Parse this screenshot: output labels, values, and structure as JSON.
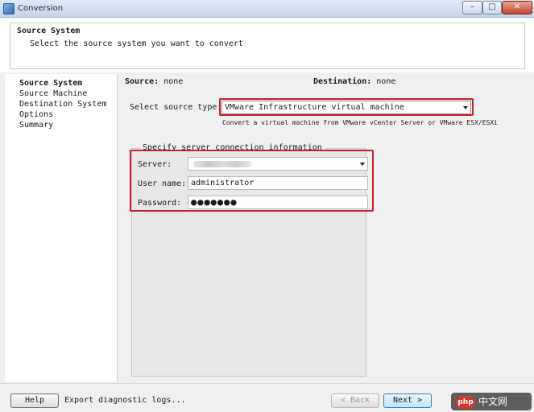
{
  "window": {
    "title": "Conversion",
    "minimize_glyph": "–",
    "maximize_glyph": "□",
    "close_glyph": "✕"
  },
  "header": {
    "title": "Source System",
    "subtitle": "Select the source system you want to convert"
  },
  "nav": {
    "items": [
      {
        "label": "Source System",
        "active": true
      },
      {
        "label": "Source Machine",
        "active": false
      },
      {
        "label": "Destination System",
        "active": false
      },
      {
        "label": "Options",
        "active": false
      },
      {
        "label": "Summary",
        "active": false
      }
    ]
  },
  "summary": {
    "source_label": "Source:",
    "source_value": "none",
    "destination_label": "Destination:",
    "destination_value": "none"
  },
  "source_type": {
    "label": "Select source type:",
    "value": "VMware Infrastructure virtual machine",
    "hint": "Convert a virtual machine from VMware vCenter Server or VMware ESX/ESXi"
  },
  "connection": {
    "group_title": "Specify server connection information",
    "server_label": "Server:",
    "server_value": "",
    "username_label": "User name:",
    "username_value": "administrator",
    "password_label": "Password:",
    "password_value": "●●●●●●●"
  },
  "footer": {
    "help_label": "Help",
    "export_logs_label": "Export diagnostic logs...",
    "back_label": "< Back",
    "next_label": "Next >"
  },
  "watermark": {
    "badge": "php",
    "text": "中文网"
  },
  "colors": {
    "highlight_box": "#c8202a",
    "title_bar": "#c4d5ea",
    "panel_bg": "#f0f0f0"
  }
}
